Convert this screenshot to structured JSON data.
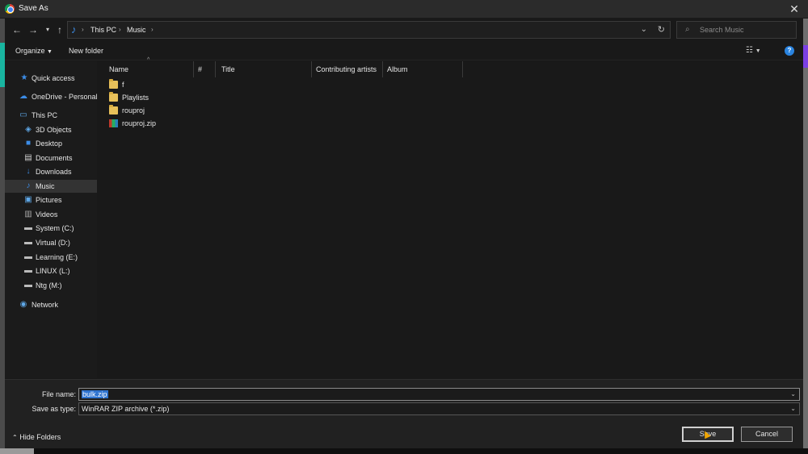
{
  "window": {
    "title": "Save As",
    "close_symbol": "✕"
  },
  "address": {
    "root_label": "This PC",
    "folder_label": "Music"
  },
  "search": {
    "placeholder": "Search Music"
  },
  "toolbar": {
    "organize_label": "Organize",
    "new_folder_label": "New folder"
  },
  "sidebar": {
    "items": [
      {
        "label": "Quick access",
        "icon": "star-icon"
      },
      {
        "label": "OneDrive - Personal",
        "icon": "cloud-icon"
      },
      {
        "label": "This PC",
        "icon": "computer-icon"
      },
      {
        "label": "3D Objects",
        "icon": "cube-icon"
      },
      {
        "label": "Desktop",
        "icon": "desktop-icon"
      },
      {
        "label": "Documents",
        "icon": "document-icon"
      },
      {
        "label": "Downloads",
        "icon": "download-icon"
      },
      {
        "label": "Music",
        "icon": "music-icon",
        "selected": true
      },
      {
        "label": "Pictures",
        "icon": "picture-icon"
      },
      {
        "label": "Videos",
        "icon": "video-icon"
      },
      {
        "label": "System (C:)",
        "icon": "drive-icon"
      },
      {
        "label": "Virtual (D:)",
        "icon": "drive-icon"
      },
      {
        "label": "Learning (E:)",
        "icon": "drive-icon"
      },
      {
        "label": "LINUX (L:)",
        "icon": "drive-icon"
      },
      {
        "label": "Ntg (M:)",
        "icon": "drive-icon"
      },
      {
        "label": "Network",
        "icon": "network-icon"
      }
    ]
  },
  "columns": [
    "Name",
    "#",
    "Title",
    "Contributing artists",
    "Album"
  ],
  "files": [
    {
      "name": "f",
      "type": "folder"
    },
    {
      "name": "Playlists",
      "type": "folder"
    },
    {
      "name": "rouproj",
      "type": "folder"
    },
    {
      "name": "rouproj.zip",
      "type": "zip"
    }
  ],
  "save": {
    "file_name_label": "File name:",
    "file_name_value": "bulk.zip",
    "save_as_type_label": "Save as type:",
    "save_as_type_value": "WinRAR ZIP archive (*.zip)",
    "hide_folders_label": "Hide Folders",
    "save_button": "Save",
    "cancel_button": "Cancel"
  },
  "colors": {
    "accent": "#2f74d0",
    "background": "#191919",
    "music_icon": "#3c8ce6"
  }
}
